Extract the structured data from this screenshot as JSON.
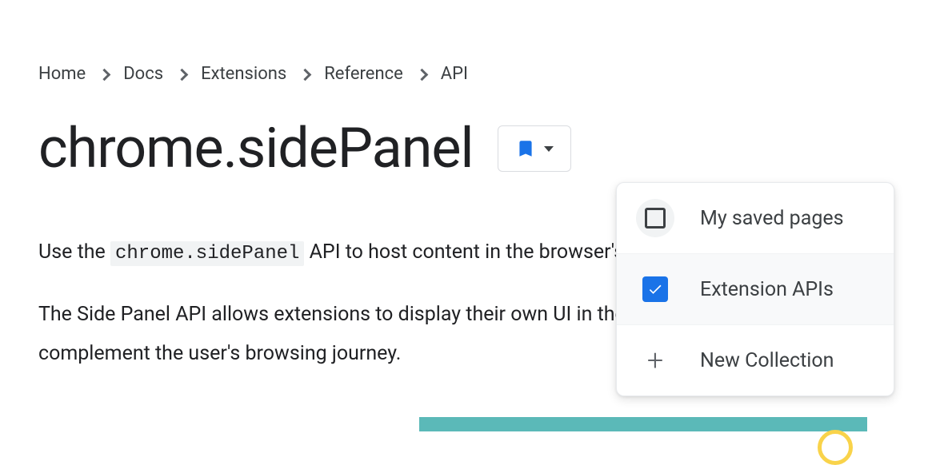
{
  "breadcrumb": {
    "items": [
      "Home",
      "Docs",
      "Extensions",
      "Reference",
      "API"
    ]
  },
  "page": {
    "title": "chrome.sidePanel"
  },
  "intro": {
    "p1_prefix": "Use the ",
    "p1_code": "chrome.sidePanel",
    "p1_suffix": " API to host content in the browser's side panel alongside th",
    "p2": "The Side Panel API allows extensions to display their own UI in the side panel, enabling p complement the user's browsing journey."
  },
  "bookmark_menu": {
    "items": [
      {
        "label": "My saved pages",
        "checked": false
      },
      {
        "label": "Extension APIs",
        "checked": true
      },
      {
        "label": "New Collection",
        "action": "new"
      }
    ]
  }
}
